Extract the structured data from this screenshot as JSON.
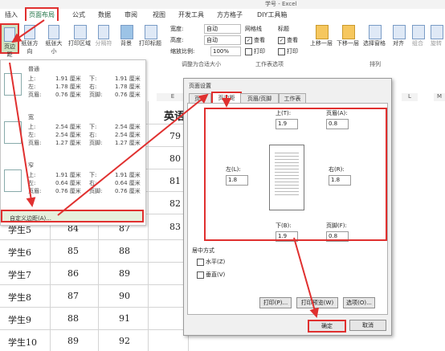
{
  "window": {
    "title": "学号 - Excel"
  },
  "ribbon": {
    "tabs": [
      "插入",
      "页面布局",
      "公式",
      "数据",
      "审阅",
      "视图",
      "开发工具",
      "方方格子",
      "DIY工具箱"
    ],
    "active_tab": "页面布局",
    "buttons": {
      "margins": "页边距",
      "orientation": "纸张方向",
      "size": "纸张大小",
      "print_area": "打印区域",
      "breaks": "分隔符",
      "background": "背景",
      "print_titles": "打印标题"
    },
    "scale": {
      "width_label": "宽度:",
      "width_value": "自动",
      "height_label": "高度:",
      "height_value": "自动",
      "zoom_label": "缩放比例:",
      "zoom_value": "100%",
      "group_label": "调整为合适大小"
    },
    "sheet_options": {
      "gridlines": "网格线",
      "headings": "标题",
      "view1": "查看",
      "view2": "查看",
      "print1": "打印",
      "print2": "打印",
      "group_label": "工作表选项"
    },
    "arrange": {
      "bring_forward": "上移一层",
      "send_backward": "下移一层",
      "selection_pane": "选择窗格",
      "align": "对齐",
      "group": "组合",
      "rotate": "旋转",
      "group_label": "排列"
    }
  },
  "margins_menu": {
    "presets": [
      {
        "name": "普通",
        "top_l": "上:",
        "top": "1.91 厘米",
        "bottom_l": "下:",
        "bottom": "1.91 厘米",
        "left_l": "左:",
        "left": "1.78 厘米",
        "right_l": "右:",
        "right": "1.78 厘米",
        "header_l": "页眉:",
        "header": "0.76 厘米",
        "footer_l": "页脚:",
        "footer": "0.76 厘米"
      },
      {
        "name": "宽",
        "top_l": "上:",
        "top": "2.54 厘米",
        "bottom_l": "下:",
        "bottom": "2.54 厘米",
        "left_l": "左:",
        "left": "2.54 厘米",
        "right_l": "右:",
        "right": "2.54 厘米",
        "header_l": "页眉:",
        "header": "1.27 厘米",
        "footer_l": "页脚:",
        "footer": "1.27 厘米"
      },
      {
        "name": "窄",
        "top_l": "上:",
        "top": "1.91 厘米",
        "bottom_l": "下:",
        "bottom": "1.91 厘米",
        "left_l": "左:",
        "left": "0.64 厘米",
        "right_l": "右:",
        "right": "0.64 厘米",
        "header_l": "页眉:",
        "header": "0.76 厘米",
        "footer_l": "页脚:",
        "footer": "0.76 厘米"
      }
    ],
    "custom": "自定义边距(A)..."
  },
  "sheet": {
    "col_headers": [
      "E",
      "L",
      "M"
    ],
    "header_cell": "英语",
    "english_top": [
      "79",
      "80",
      "81",
      "82",
      "83"
    ],
    "rows": [
      {
        "name": "学生5",
        "c1": "84",
        "c2": "87"
      },
      {
        "name": "学生6",
        "c1": "85",
        "c2": "88"
      },
      {
        "name": "学生7",
        "c1": "86",
        "c2": "89"
      },
      {
        "name": "学生8",
        "c1": "87",
        "c2": "90"
      },
      {
        "name": "学生9",
        "c1": "88",
        "c2": "91"
      },
      {
        "name": "学生10",
        "c1": "89",
        "c2": "92"
      }
    ]
  },
  "dialog": {
    "title": "页面设置",
    "tabs": [
      "页面",
      "页边距",
      "页眉/页脚",
      "工作表"
    ],
    "active_tab": "页边距",
    "fields": {
      "top_label": "上(T):",
      "top": "1.9",
      "header_label": "页眉(A):",
      "header": "0.8",
      "left_label": "左(L):",
      "left": "1.8",
      "right_label": "右(R):",
      "right": "1.8",
      "bottom_label": "下(B):",
      "bottom": "1.9",
      "footer_label": "页脚(F):",
      "footer": "0.8"
    },
    "center_label": "居中方式",
    "horizontal": "水平(Z)",
    "vertical": "垂直(V)",
    "buttons": {
      "print": "打印(P)...",
      "preview": "打印预览(W)",
      "options": "选项(O)...",
      "ok": "确定",
      "cancel": "取消"
    }
  },
  "colors": {
    "accent": "#217346",
    "highlight": "#e0302f"
  }
}
